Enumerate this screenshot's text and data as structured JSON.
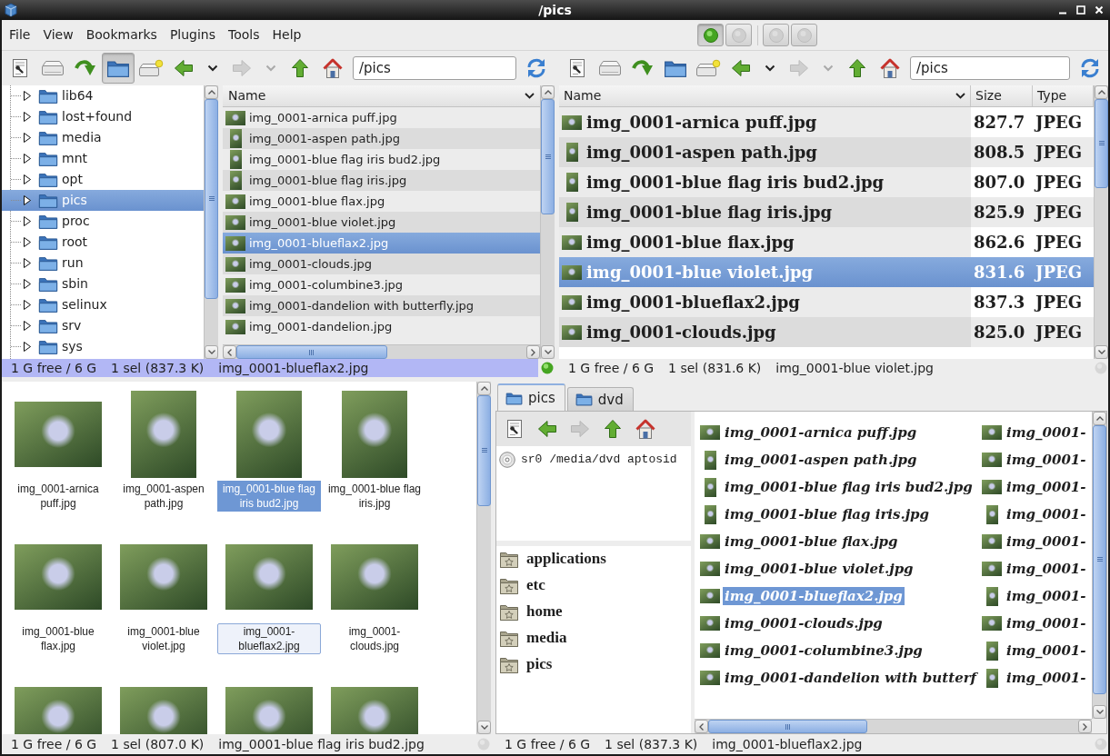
{
  "window": {
    "title": "/pics"
  },
  "menu": [
    "File",
    "View",
    "Bookmarks",
    "Plugins",
    "Tools",
    "Help"
  ],
  "pane_buttons": [
    {
      "active": true
    },
    {
      "active": false
    },
    {
      "active": false
    },
    {
      "active": false
    }
  ],
  "top_left_pane": {
    "toolbar": [
      {
        "kind": "properties",
        "pressed": false,
        "disabled": false
      },
      {
        "kind": "drive",
        "pressed": false,
        "disabled": false
      },
      {
        "kind": "reload",
        "pressed": false,
        "disabled": false
      },
      {
        "kind": "tree",
        "pressed": true,
        "disabled": false
      },
      {
        "kind": "new-drive",
        "pressed": false,
        "disabled": false
      },
      {
        "kind": "back",
        "pressed": false,
        "disabled": false
      },
      {
        "kind": "history",
        "pressed": false,
        "disabled": false
      },
      {
        "kind": "forward",
        "pressed": false,
        "disabled": true
      },
      {
        "kind": "history",
        "pressed": false,
        "disabled": true
      },
      {
        "kind": "up",
        "pressed": false,
        "disabled": false
      },
      {
        "kind": "home",
        "pressed": false,
        "disabled": false
      }
    ],
    "path": "/pics",
    "tree": [
      {
        "label": "lib64",
        "expanded": false,
        "selected": false
      },
      {
        "label": "lost+found",
        "expanded": false,
        "selected": false
      },
      {
        "label": "media",
        "expanded": false,
        "selected": false
      },
      {
        "label": "mnt",
        "expanded": false,
        "selected": false
      },
      {
        "label": "opt",
        "expanded": false,
        "selected": false
      },
      {
        "label": "pics",
        "expanded": false,
        "selected": true
      },
      {
        "label": "proc",
        "expanded": false,
        "selected": false
      },
      {
        "label": "root",
        "expanded": false,
        "selected": false
      },
      {
        "label": "run",
        "expanded": false,
        "selected": false
      },
      {
        "label": "sbin",
        "expanded": false,
        "selected": false
      },
      {
        "label": "selinux",
        "expanded": false,
        "selected": false
      },
      {
        "label": "srv",
        "expanded": false,
        "selected": false
      },
      {
        "label": "sys",
        "expanded": false,
        "selected": false
      }
    ],
    "file_list": {
      "columns": [
        "Name"
      ],
      "rows": [
        {
          "name": "img_0001-arnica puff.jpg",
          "portrait": false,
          "selected": false
        },
        {
          "name": "img_0001-aspen path.jpg",
          "portrait": true,
          "selected": false
        },
        {
          "name": "img_0001-blue flag iris bud2.jpg",
          "portrait": true,
          "selected": false
        },
        {
          "name": "img_0001-blue flag iris.jpg",
          "portrait": true,
          "selected": false
        },
        {
          "name": "img_0001-blue flax.jpg",
          "portrait": false,
          "selected": false
        },
        {
          "name": "img_0001-blue violet.jpg",
          "portrait": false,
          "selected": false
        },
        {
          "name": "img_0001-blueflax2.jpg",
          "portrait": false,
          "selected": true
        },
        {
          "name": "img_0001-clouds.jpg",
          "portrait": false,
          "selected": false
        },
        {
          "name": "img_0001-columbine3.jpg",
          "portrait": false,
          "selected": false
        },
        {
          "name": "img_0001-dandelion with butterfly.jpg",
          "portrait": false,
          "selected": false
        },
        {
          "name": "img_0001-dandelion.jpg",
          "portrait": false,
          "selected": false
        }
      ]
    },
    "status": {
      "free": "1 G free / 6 G",
      "selection": "1 sel (837.3 K)",
      "file": "img_0001-blueflax2.jpg",
      "active": true
    }
  },
  "top_right_pane": {
    "toolbar": [
      {
        "kind": "properties",
        "pressed": false,
        "disabled": false
      },
      {
        "kind": "drive",
        "pressed": false,
        "disabled": false
      },
      {
        "kind": "reload",
        "pressed": false,
        "disabled": false
      },
      {
        "kind": "tree",
        "pressed": false,
        "disabled": false
      },
      {
        "kind": "new-drive",
        "pressed": false,
        "disabled": false
      },
      {
        "kind": "back",
        "pressed": false,
        "disabled": false
      },
      {
        "kind": "history",
        "pressed": false,
        "disabled": false
      },
      {
        "kind": "forward",
        "pressed": false,
        "disabled": true
      },
      {
        "kind": "history",
        "pressed": false,
        "disabled": true
      },
      {
        "kind": "up",
        "pressed": false,
        "disabled": false
      },
      {
        "kind": "home",
        "pressed": false,
        "disabled": false
      }
    ],
    "path": "/pics",
    "file_list": {
      "columns": [
        "Name",
        "Size",
        "Type"
      ],
      "rows": [
        {
          "name": "img_0001-arnica puff.jpg",
          "size": "827.7",
          "type": "JPEG",
          "portrait": false,
          "selected": false
        },
        {
          "name": "img_0001-aspen path.jpg",
          "size": "808.5",
          "type": "JPEG",
          "portrait": true,
          "selected": false
        },
        {
          "name": "img_0001-blue flag iris bud2.jpg",
          "size": "807.0",
          "type": "JPEG",
          "portrait": true,
          "selected": false
        },
        {
          "name": "img_0001-blue flag iris.jpg",
          "size": "825.9",
          "type": "JPEG",
          "portrait": true,
          "selected": false
        },
        {
          "name": "img_0001-blue flax.jpg",
          "size": "862.6",
          "type": "JPEG",
          "portrait": false,
          "selected": false
        },
        {
          "name": "img_0001-blue violet.jpg",
          "size": "831.6",
          "type": "JPEG",
          "portrait": false,
          "selected": true
        },
        {
          "name": "img_0001-blueflax2.jpg",
          "size": "837.3",
          "type": "JPEG",
          "portrait": false,
          "selected": false
        },
        {
          "name": "img_0001-clouds.jpg",
          "size": "825.0",
          "type": "JPEG",
          "portrait": false,
          "selected": false
        }
      ]
    },
    "status": {
      "free": "1 G free / 6 G",
      "selection": "1 sel (831.6 K)",
      "file": "img_0001-blue violet.jpg",
      "active": false
    }
  },
  "bottom_left_pane": {
    "icon_view": [
      {
        "label": "img_0001-arnica puff.jpg",
        "portrait": false,
        "selected": false,
        "focused": false
      },
      {
        "label": "img_0001-aspen path.jpg",
        "portrait": true,
        "selected": false,
        "focused": false
      },
      {
        "label": "img_0001-blue flag iris bud2.jpg",
        "portrait": true,
        "selected": true,
        "focused": false
      },
      {
        "label": "img_0001-blue flag iris.jpg",
        "portrait": true,
        "selected": false,
        "focused": false
      },
      {
        "label": "img_0001-blue flax.jpg",
        "portrait": false,
        "selected": false,
        "focused": false
      },
      {
        "label": "img_0001-blue violet.jpg",
        "portrait": false,
        "selected": false,
        "focused": false
      },
      {
        "label": "img_0001-blueflax2.jpg",
        "portrait": false,
        "selected": false,
        "focused": true
      },
      {
        "label": "img_0001-clouds.jpg",
        "portrait": false,
        "selected": false,
        "focused": false
      },
      {
        "portrait": false,
        "selected": false
      },
      {
        "portrait": false,
        "selected": false
      },
      {
        "portrait": false,
        "selected": false
      },
      {
        "portrait": false,
        "selected": false
      }
    ],
    "status": {
      "free": "1 G free / 6 G",
      "selection": "1 sel (807.0 K)",
      "file": "img_0001-blue flag iris bud2.jpg",
      "active": false
    }
  },
  "bottom_right_pane": {
    "tabs": [
      {
        "label": "pics",
        "selected": true
      },
      {
        "label": "dvd",
        "selected": false
      }
    ],
    "side_toolbar": [
      {
        "kind": "properties",
        "disabled": false
      },
      {
        "kind": "back",
        "disabled": false
      },
      {
        "kind": "forward",
        "disabled": true
      },
      {
        "kind": "up",
        "disabled": false
      },
      {
        "kind": "home",
        "disabled": false
      }
    ],
    "devices": [
      "sr0 /media/dvd aptosid"
    ],
    "bookmarks": [
      "applications",
      "etc",
      "home",
      "media",
      "pics"
    ],
    "compact_list": [
      {
        "name": "img_0001-arnica puff.jpg",
        "portrait": false,
        "selected": false
      },
      {
        "name": "img_0001-aspen path.jpg",
        "portrait": true,
        "selected": false
      },
      {
        "name": "img_0001-blue flag iris bud2.jpg",
        "portrait": true,
        "selected": false
      },
      {
        "name": "img_0001-blue flag iris.jpg",
        "portrait": true,
        "selected": false
      },
      {
        "name": "img_0001-blue flax.jpg",
        "portrait": false,
        "selected": false
      },
      {
        "name": "img_0001-blue violet.jpg",
        "portrait": false,
        "selected": false
      },
      {
        "name": "img_0001-blueflax2.jpg",
        "portrait": false,
        "selected": true
      },
      {
        "name": "img_0001-clouds.jpg",
        "portrait": false,
        "selected": false
      },
      {
        "name": "img_0001-columbine3.jpg",
        "portrait": false,
        "selected": false
      },
      {
        "name": "img_0001-dandelion with butterf",
        "portrait": false,
        "selected": false
      },
      {
        "name": "img_0001-",
        "portrait": false,
        "selected": false
      },
      {
        "name": "img_0001-",
        "portrait": false,
        "selected": false
      },
      {
        "name": "img_0001-",
        "portrait": false,
        "selected": false
      },
      {
        "name": "img_0001-",
        "portrait": true,
        "selected": false
      },
      {
        "name": "img_0001-",
        "portrait": false,
        "selected": false
      },
      {
        "name": "img_0001-",
        "portrait": false,
        "selected": false
      },
      {
        "name": "img_0001-",
        "portrait": true,
        "selected": false
      },
      {
        "name": "img_0001-",
        "portrait": false,
        "selected": false
      },
      {
        "name": "img_0001-",
        "portrait": true,
        "selected": false
      },
      {
        "name": "img_0001-",
        "portrait": true,
        "selected": false
      }
    ],
    "status": {
      "free": "1 G free / 6 G",
      "selection": "1 sel (837.3 K)",
      "file": "img_0001-blueflax2.jpg",
      "active": false
    }
  }
}
